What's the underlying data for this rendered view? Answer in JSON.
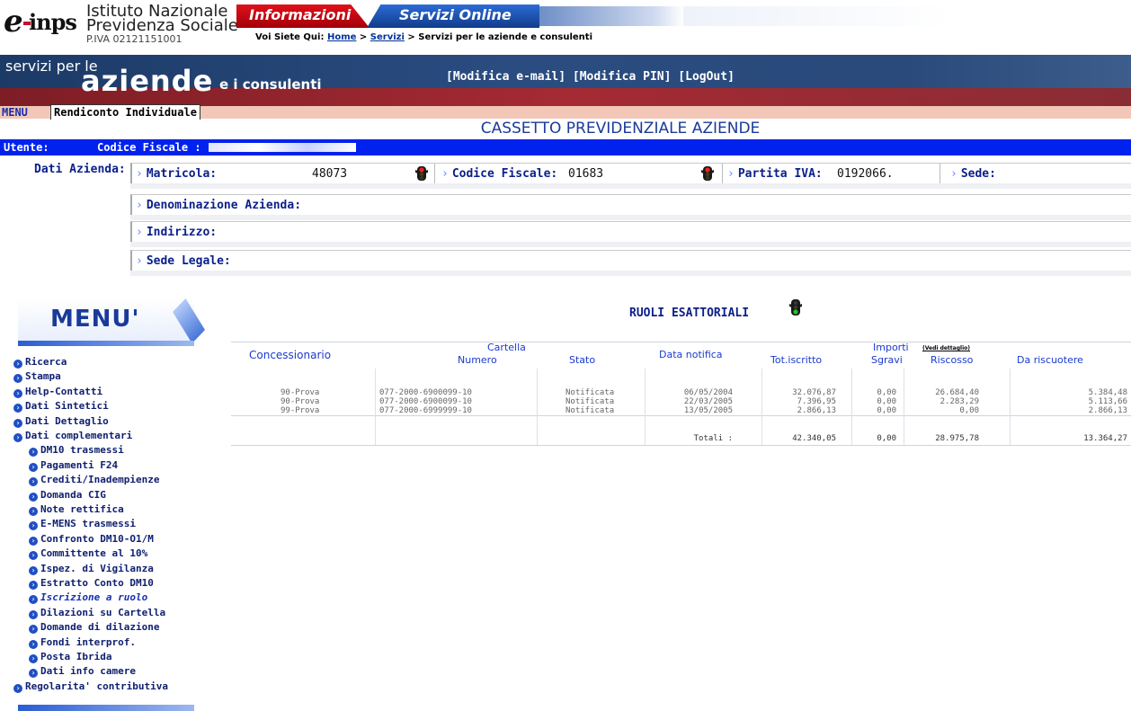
{
  "header": {
    "logo": "e-inps",
    "institute_line1": "Istituto Nazionale",
    "institute_line2": "Previdenza Sociale",
    "piva": "P.IVA 02121151001",
    "tab_info": "Informazioni",
    "tab_servizi": "Servizi Online",
    "breadcrumb": {
      "prefix": "Voi Siete Qui:",
      "home": "Home",
      "sep1": ">",
      "servizi": "Servizi",
      "sep2": ">",
      "current": "Servizi per le aziende e consulenti"
    }
  },
  "banner": {
    "servizi_per_le": "servizi per le",
    "aziende": "aziende",
    "consulenti": "e i consulenti",
    "link_email": "[Modifica e-mail]",
    "link_pin": "[Modifica PIN]",
    "link_logout": "[LogOut]"
  },
  "tabs": {
    "menu": "MENU",
    "rendiconto": "Rendiconto Individuale"
  },
  "page_title": "CASSETTO PREVIDENZIALE AZIENDE",
  "userbar": {
    "utente": "Utente:",
    "codice_fiscale": "Codice Fiscale :"
  },
  "dati_azienda": {
    "label": "Dati Azienda:",
    "matricola_label": "Matricola:",
    "matricola_value": "48073",
    "cf_label": "Codice Fiscale:",
    "cf_value": "01683",
    "piva_label": "Partita IVA:",
    "piva_value": "0192066.",
    "sede_label": "Sede:",
    "denominazione_label": "Denominazione Azienda:",
    "indirizzo_label": "Indirizzo:",
    "sede_legale_label": "Sede Legale:"
  },
  "menu": {
    "title": "MENU'",
    "items": [
      {
        "label": "Ricerca",
        "level": 0
      },
      {
        "label": "Stampa",
        "level": 0
      },
      {
        "label": "Help-Contatti",
        "level": 0
      },
      {
        "label": "Dati Sintetici",
        "level": 0
      },
      {
        "label": "Dati Dettaglio",
        "level": 0
      },
      {
        "label": "Dati complementari",
        "level": 0
      },
      {
        "label": "DM10 trasmessi",
        "level": 1
      },
      {
        "label": "Pagamenti F24",
        "level": 1
      },
      {
        "label": "Crediti/Inadempienze",
        "level": 1
      },
      {
        "label": "Domanda CIG",
        "level": 1
      },
      {
        "label": "Note rettifica",
        "level": 1
      },
      {
        "label": "E-MENS trasmessi",
        "level": 1
      },
      {
        "label": "Confronto DM10-O1/M",
        "level": 1
      },
      {
        "label": "Committente al 10%",
        "level": 1
      },
      {
        "label": "Ispez. di Vigilanza",
        "level": 1
      },
      {
        "label": "Estratto Conto DM10",
        "level": 1
      },
      {
        "label": "Iscrizione a ruolo",
        "level": 1,
        "active": true
      },
      {
        "label": "Dilazioni su Cartella",
        "level": 1
      },
      {
        "label": "Domande di dilazione",
        "level": 1
      },
      {
        "label": "Fondi interprof.",
        "level": 1
      },
      {
        "label": "Posta Ibrida",
        "level": 1
      },
      {
        "label": "Dati info camere",
        "level": 1
      },
      {
        "label": "Regolarita' contributiva",
        "level": 0
      }
    ]
  },
  "ruoli": {
    "title": "RUOLI ESATTORIALI",
    "headers": {
      "concessionario": "Concessionario",
      "cartella": "Cartella",
      "numero": "Numero",
      "stato": "Stato",
      "data_notifica": "Data notifica",
      "importi": "Importi",
      "vedi_dettaglio": "(Vedi dettaglio)",
      "tot_iscritto": "Tot.iscritto",
      "sgravi": "Sgravi",
      "riscosso": "Riscosso",
      "da_riscuotere": "Da riscuotere"
    },
    "rows": [
      {
        "concessionario": "90-Prova",
        "numero": "077-2000-6900099-10",
        "stato": "Notificata",
        "data": "06/05/2004",
        "tot": "32.076,87",
        "sgravi": "0,00",
        "riscosso": "26.684,40",
        "da": "5.384,48"
      },
      {
        "concessionario": "90-Prova",
        "numero": "077-2000-6900099-10",
        "stato": "Notificata",
        "data": "22/03/2005",
        "tot": "7.396,95",
        "sgravi": "0,00",
        "riscosso": "2.283,29",
        "da": "5.113,66"
      },
      {
        "concessionario": "99-Prova",
        "numero": "077-2000-6999999-10",
        "stato": "Notificata",
        "data": "13/05/2005",
        "tot": "2.866,13",
        "sgravi": "0,00",
        "riscosso": "0,00",
        "da": "2.866,13"
      }
    ],
    "totals": {
      "label": "Totali :",
      "tot": "42.340,05",
      "sgravi": "0,00",
      "riscosso": "28.975,78",
      "da": "13.364,27"
    }
  },
  "colors": {
    "accent_blue": "#0022ee",
    "banner_blue": "#1c3a66",
    "banner_red": "#a52a34",
    "light_red": "#f2c7b8",
    "link_blue": "#0a1f8a"
  },
  "icons": [
    "traffic-light-red-icon",
    "traffic-light-green-icon",
    "arrow-circle-icon",
    "chevron-right-icon"
  ]
}
